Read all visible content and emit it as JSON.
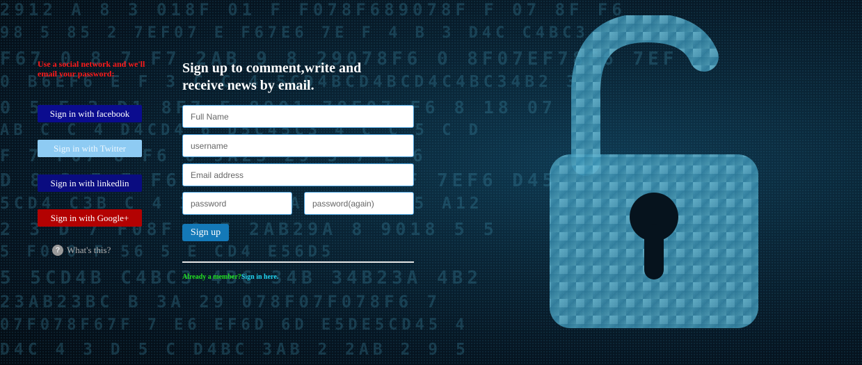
{
  "social": {
    "note": "Use a social network and we'll email your password:",
    "facebook_label": "Sign in with facebook",
    "twitter_label": "Sign in with Twitter",
    "linkedin_label": "Sign in with linkedlin",
    "google_label": "Sign in with Google+",
    "whats_this_label": "What's this?",
    "help_icon_glyph": "?"
  },
  "signup": {
    "heading": "Sign up to comment,write and receive news by email.",
    "full_name_placeholder": "Full Name",
    "username_placeholder": "username",
    "email_placeholder": "Email address",
    "password_placeholder": "password",
    "password_again_placeholder": "password(again)",
    "submit_label": "Sign up",
    "already_member_text": "Already a member?",
    "sign_in_link": "Sign in here."
  },
  "colors": {
    "facebook": "#0b0c8f",
    "twitter": "#8ecbf3",
    "linkedin": "#0a0c80",
    "google": "#b30202",
    "note_red": "#ff1a1a",
    "submit_blue": "#1479b8",
    "member_green": "#22e022",
    "link_cyan": "#21d4f0"
  },
  "background": {
    "hex_rows": [
      "2912 A 8 3 018F 01 F F078F689078F F 07 8F F6",
      "98 5 85 2 7EF07 E F67E6 7E F 4 B 3 D4C C4BC3",
      "F67 0 8 7 F7 2AB 9 8 29078F6 0 8F07EF78F6 7EF",
      "0 B6EF6 E F 3 C C 4 5CD4BCD4BCD4C4BC34B2 3",
      "0 5 E 2 D1 8F7 F 8901 78F07 F6 8 18 07",
      "AB C C 4 D4CD4 6 D5C45C3 4 C C 5 C D",
      "F 7 F07 8 F6 0 9A23 29 5 7 E 6",
      "D 8 3 E E F67E67E6 F 67E 7EF 7EF6 D45",
      "5CD4 C3B C 4 3 5CD C ABC 45C345 A12",
      "2 3 D 7 F08F 0 F 2AB29A 8 9018 5 5",
      "5 F0 0 F 56 5 E CD4 E56D5",
      "5 5CD4B C4BC3 4BC 34B 34B23A 4B2",
      "23AB23BC B 3A 29 078F07F078F6 7",
      "07F078F67F 7 E6 EF6D 6D E5DE5CD45 4",
      "D4C 4 3 D 5 C D4BC 3AB 2 2AB 2 9 5"
    ]
  }
}
